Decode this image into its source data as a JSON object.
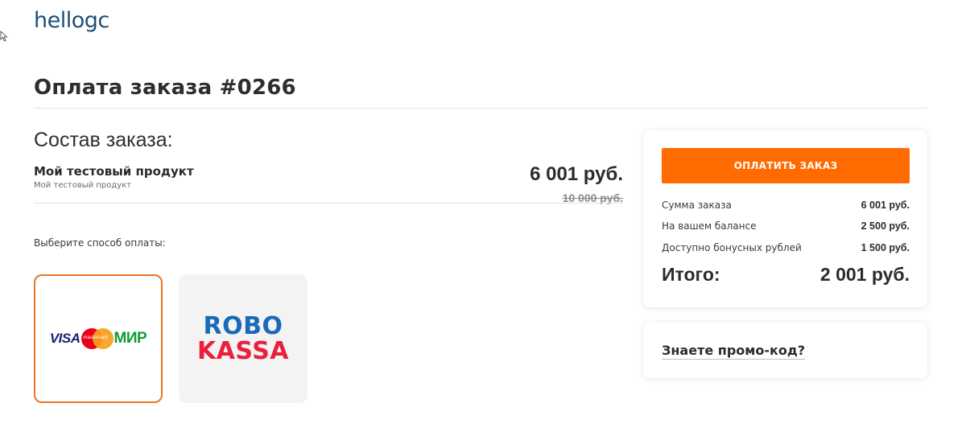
{
  "brand": {
    "logo_text": "hellogc",
    "accent_color": "#ff6b00",
    "logo_color": "#1e4e79"
  },
  "page": {
    "title": "Оплата заказа #0266"
  },
  "order": {
    "heading": "Состав заказа:",
    "items": [
      {
        "name": "Мой тестовый продукт",
        "subtitle": "Мой тестовый продукт",
        "price": "6 001 руб.",
        "old_price": "10 000 руб."
      }
    ]
  },
  "payment": {
    "label": "Выберите способ оплаты:",
    "options": [
      {
        "id": "cards",
        "selected": true,
        "logo_parts": {
          "visa": "VISA",
          "mastercard": "mastercard",
          "mir": "МИР"
        }
      },
      {
        "id": "robokassa",
        "selected": false,
        "logo_parts": {
          "top": "ROBO",
          "bottom": "KASSA"
        }
      }
    ]
  },
  "summary": {
    "pay_button_label": "ОПЛАТИТЬ ЗАКАЗ",
    "rows": [
      {
        "label": "Сумма заказа",
        "value": "6 001 руб."
      },
      {
        "label": "На вашем балансе",
        "value": "2 500 руб."
      },
      {
        "label": "Доступно бонусных рублей",
        "value": "1 500 руб."
      }
    ],
    "total_label": "Итого:",
    "total_value": "2 001 руб."
  },
  "promo": {
    "link_label": "Знаете промо-код?"
  }
}
